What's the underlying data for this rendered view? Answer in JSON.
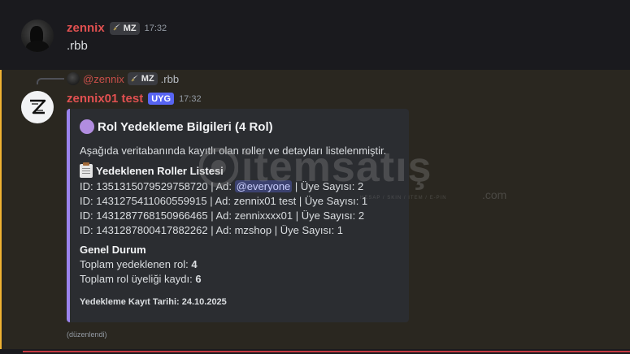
{
  "message1": {
    "username": "zennix",
    "username_color": "#e05050",
    "tag": "MZ",
    "time": "17:32",
    "content": ".rbb"
  },
  "message2": {
    "reply": {
      "username": "@zennix",
      "tag": "MZ",
      "content": ".rbb"
    },
    "username": "zennix01 test",
    "username_color": "#e05050",
    "app_tag": "UYG",
    "time": "17:32",
    "edited": "(düzenlendi)",
    "embed": {
      "accent_color": "#9b84ee",
      "title": "Rol Yedekleme Bilgileri (4 Rol)",
      "description": "Aşağıda veritabanında kayıtlı olan roller ve detayları listelenmiştir.",
      "roles_field": {
        "name": "Yedeklenen Roller Listesi",
        "rows": [
          {
            "prefix": "ID: 1351315079529758720 | Ad: ",
            "mention": "@everyone",
            "suffix": " | Üye Sayısı: 2"
          },
          {
            "text": "ID: 1431275411060559915 | Ad: zennix01 test | Üye Sayısı: 1"
          },
          {
            "text": "ID: 1431287768150966465 | Ad: zennixxxx01 | Üye Sayısı: 2"
          },
          {
            "text": "ID: 1431287800417882262 | Ad: mzshop | Üye Sayısı: 1"
          }
        ]
      },
      "summary_field": {
        "name": "Genel Durum",
        "line1_label": "Toplam yedeklenen rol: ",
        "line1_value": "4",
        "line2_label": "Toplam rol üyeliği kaydı: ",
        "line2_value": "6"
      },
      "footer": "Yedekleme Kayıt Tarihi: 24.10.2025"
    }
  },
  "watermark": {
    "text": "itemsatış",
    "sub": "HESAP / SKIN / ITEM / E-PIN",
    "suffix": ".com"
  }
}
